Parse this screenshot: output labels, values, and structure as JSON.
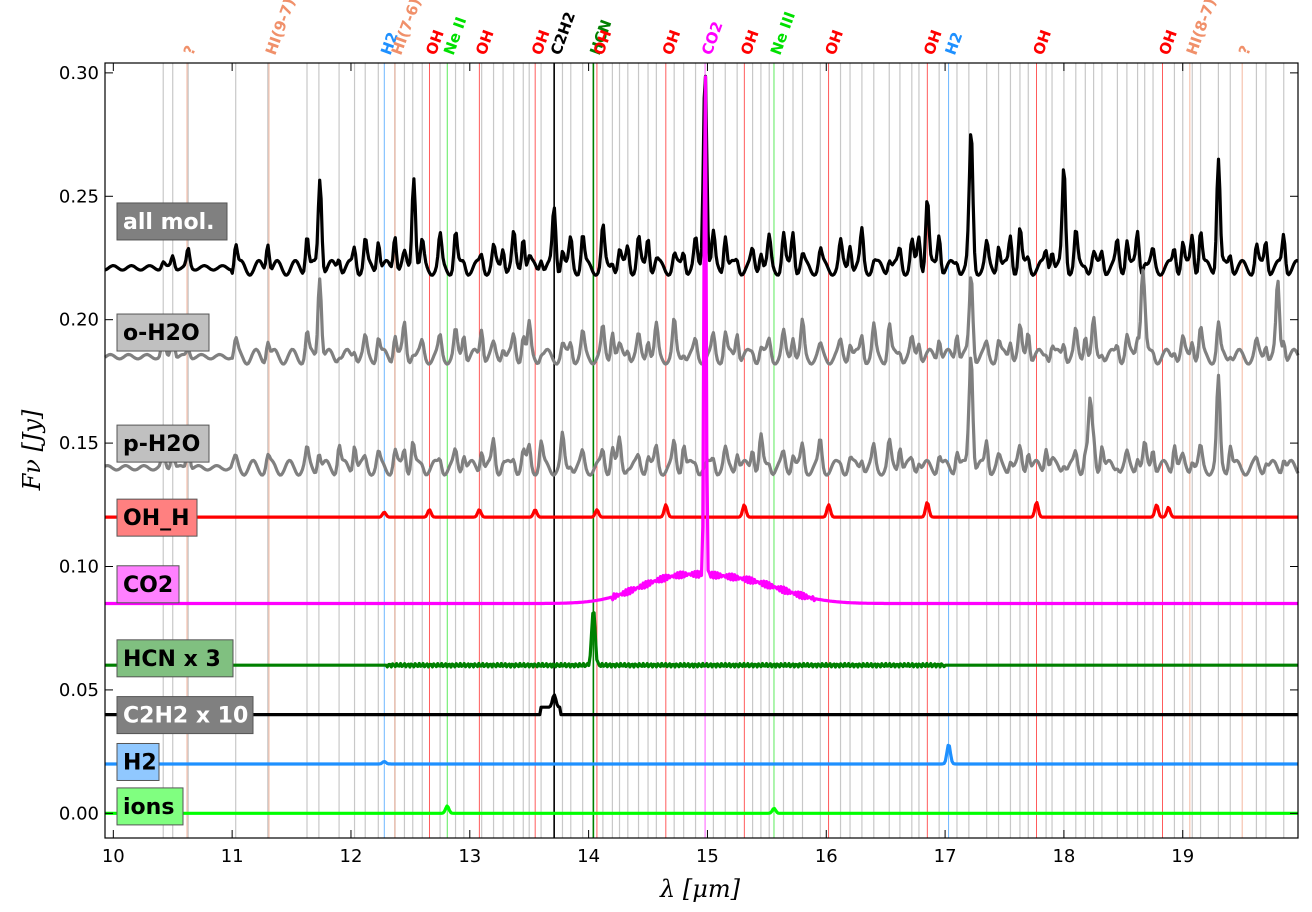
{
  "chart_data": {
    "type": "line",
    "title": "",
    "xlabel": "λ [μm]",
    "ylabel": "Fν [Jy]",
    "xlim": [
      9.93,
      19.97
    ],
    "ylim": [
      -0.01,
      0.304
    ],
    "x_ticks": [
      10,
      11,
      12,
      13,
      14,
      15,
      16,
      17,
      18,
      19
    ],
    "y_ticks": [
      0.0,
      0.05,
      0.1,
      0.15,
      0.2,
      0.25,
      0.3
    ],
    "y_tick_labels": [
      "0.00",
      "0.05",
      "0.10",
      "0.15",
      "0.20",
      "0.25",
      "0.30"
    ],
    "grid": false,
    "water_line_positions": [
      10.42,
      10.5,
      10.63,
      11.03,
      11.3,
      11.63,
      11.73,
      11.9,
      12.03,
      12.12,
      12.23,
      12.37,
      12.45,
      12.52,
      12.6,
      12.75,
      12.88,
      12.95,
      13.1,
      13.2,
      13.28,
      13.37,
      13.45,
      13.5,
      13.6,
      13.78,
      13.85,
      13.95,
      14.12,
      14.2,
      14.26,
      14.33,
      14.42,
      14.5,
      14.57,
      14.72,
      14.8,
      14.9,
      15.05,
      15.15,
      15.25,
      15.38,
      15.45,
      15.52,
      15.64,
      15.72,
      15.8,
      15.95,
      16.12,
      16.2,
      16.3,
      16.4,
      16.53,
      16.62,
      16.72,
      16.78,
      16.95,
      17.1,
      17.2,
      17.35,
      17.45,
      17.55,
      17.63,
      17.7,
      17.85,
      17.9,
      18.0,
      18.1,
      18.18,
      18.25,
      18.32,
      18.45,
      18.53,
      18.62,
      18.68,
      18.75,
      18.93,
      19.0,
      19.08,
      19.15,
      19.3,
      19.4,
      19.62,
      19.7,
      19.85
    ],
    "line_ids": [
      {
        "label": "?",
        "x": 10.62,
        "color": "#f0906a"
      },
      {
        "label": "HI(9-7)",
        "x": 11.31,
        "color": "#f0906a"
      },
      {
        "label": "H2",
        "x": 12.28,
        "color": "#1e90ff"
      },
      {
        "label": "HI(7-6)",
        "x": 12.37,
        "color": "#f0906a"
      },
      {
        "label": "OH",
        "x": 12.66,
        "color": "#ff0000"
      },
      {
        "label": "Ne II",
        "x": 12.81,
        "color": "#00e000"
      },
      {
        "label": "OH",
        "x": 13.08,
        "color": "#ff0000"
      },
      {
        "label": "OH",
        "x": 13.55,
        "color": "#ff0000"
      },
      {
        "label": "C2H2",
        "x": 13.71,
        "color": "#000000"
      },
      {
        "label": "HCN",
        "x": 14.04,
        "color": "#008000"
      },
      {
        "label": "OH",
        "x": 14.07,
        "color": "#ff0000"
      },
      {
        "label": "OH",
        "x": 14.65,
        "color": "#ff0000"
      },
      {
        "label": "CO2",
        "x": 14.98,
        "color": "#ff00ff"
      },
      {
        "label": "OH",
        "x": 15.31,
        "color": "#ff0000"
      },
      {
        "label": "Ne III",
        "x": 15.56,
        "color": "#00e000"
      },
      {
        "label": "OH",
        "x": 16.02,
        "color": "#ff0000"
      },
      {
        "label": "OH",
        "x": 16.85,
        "color": "#ff0000"
      },
      {
        "label": "H2",
        "x": 17.03,
        "color": "#1e90ff"
      },
      {
        "label": "OH",
        "x": 17.77,
        "color": "#ff0000"
      },
      {
        "label": "OH",
        "x": 18.83,
        "color": "#ff0000"
      },
      {
        "label": "HI(8-7)",
        "x": 19.06,
        "color": "#f0906a"
      },
      {
        "label": "?",
        "x": 19.5,
        "color": "#f0906a"
      }
    ],
    "series": [
      {
        "name": "all mol.",
        "color": "#000000",
        "box_color": "#808080",
        "box_text_color": "#ffffff",
        "baseline": 0.221,
        "noise": 0.03,
        "style": "dense",
        "peaks": [
          [
            11.74,
            0.256
          ],
          [
            12.53,
            0.255
          ],
          [
            14.98,
            0.304
          ],
          [
            17.22,
            0.273
          ],
          [
            19.3,
            0.262
          ],
          [
            16.85,
            0.25
          ],
          [
            18.0,
            0.25
          ],
          [
            13.71,
            0.245
          ]
        ]
      },
      {
        "name": "o-H2O",
        "color": "#808080",
        "box_color": "#c0c0c0",
        "box_text_color": "#000000",
        "baseline": 0.185,
        "noise": 0.025,
        "style": "dense",
        "peaks": [
          [
            11.74,
            0.21
          ],
          [
            17.22,
            0.218
          ],
          [
            18.66,
            0.217
          ],
          [
            19.8,
            0.214
          ]
        ]
      },
      {
        "name": "p-H2O",
        "color": "#808080",
        "box_color": "#c0c0c0",
        "box_text_color": "#000000",
        "baseline": 0.14,
        "noise": 0.022,
        "style": "dense",
        "peaks": [
          [
            17.22,
            0.185
          ],
          [
            19.3,
            0.166
          ],
          [
            18.22,
            0.165
          ]
        ]
      },
      {
        "name": "OH_H",
        "color": "#ff0000",
        "box_color": "#ff8080",
        "box_text_color": "#000000",
        "baseline": 0.12,
        "style": "lines",
        "peaks": [
          [
            12.28,
            0.122
          ],
          [
            12.66,
            0.123
          ],
          [
            13.08,
            0.123
          ],
          [
            13.55,
            0.123
          ],
          [
            14.07,
            0.123
          ],
          [
            14.65,
            0.125
          ],
          [
            15.31,
            0.125
          ],
          [
            16.02,
            0.125
          ],
          [
            16.85,
            0.126
          ],
          [
            17.77,
            0.126
          ],
          [
            18.78,
            0.125
          ],
          [
            18.88,
            0.124
          ]
        ]
      },
      {
        "name": "CO2",
        "color": "#ff00ff",
        "box_color": "#ff80ff",
        "box_text_color": "#000000",
        "baseline": 0.085,
        "style": "co2",
        "peaks": [
          [
            14.98,
            0.304
          ]
        ]
      },
      {
        "name": "HCN x 3",
        "color": "#008000",
        "box_color": "#80c080",
        "box_text_color": "#000000",
        "baseline": 0.06,
        "style": "hcn",
        "peaks": [
          [
            14.04,
            0.083
          ]
        ]
      },
      {
        "name": "C2H2 x 10",
        "color": "#000000",
        "box_color": "#808080",
        "box_text_color": "#ffffff",
        "baseline": 0.04,
        "style": "c2h2",
        "peaks": [
          [
            13.71,
            0.045
          ]
        ]
      },
      {
        "name": "H2",
        "color": "#1e90ff",
        "box_color": "#90c8ff",
        "box_text_color": "#000000",
        "baseline": 0.02,
        "style": "lines",
        "peaks": [
          [
            12.28,
            0.021
          ],
          [
            17.03,
            0.028
          ]
        ]
      },
      {
        "name": "ions",
        "color": "#00ff00",
        "box_color": "#80ff80",
        "box_text_color": "#000000",
        "baseline": 0.0,
        "style": "lines",
        "peaks": [
          [
            12.81,
            0.003
          ],
          [
            15.56,
            0.002
          ]
        ]
      }
    ]
  }
}
